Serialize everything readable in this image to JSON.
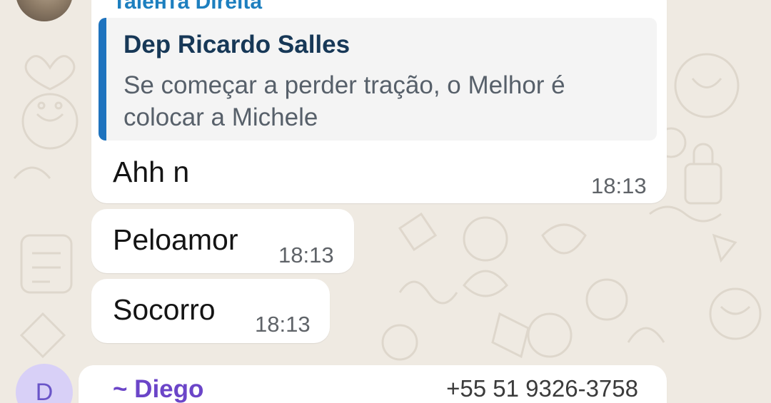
{
  "chat": {
    "top_sender": "Talента Direita",
    "messages": [
      {
        "quote": {
          "sender": "Dep Ricardo Salles",
          "text": "Se começar a perder tração, o Melhor é colocar a Michele"
        },
        "text": "Ahh n",
        "time": "18:13"
      },
      {
        "text": "Peloamor",
        "time": "18:13"
      },
      {
        "text": "Socorro",
        "time": "18:13"
      }
    ],
    "next_message": {
      "avatar_initial": "D",
      "sender": "~ Diego",
      "phone": "+55 51 9326-3758"
    }
  },
  "theme": {
    "wallpaper": "#efeae2",
    "bubble": "#ffffff",
    "quote_bar": "#1e73be",
    "quote_sender": "#173857",
    "sender_diego": "#6b45c8"
  }
}
